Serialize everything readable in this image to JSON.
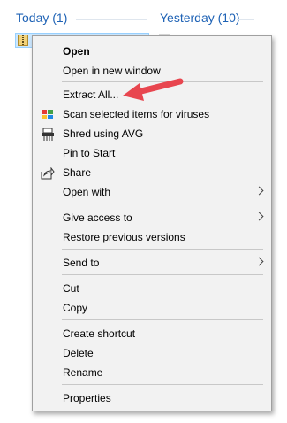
{
  "groups": {
    "today": "Today (1)",
    "yesterday": "Yesterday (10)"
  },
  "context_menu": {
    "items": [
      {
        "label": "Open",
        "bold": true
      },
      {
        "label": "Open in new window"
      },
      {
        "label": "Extract All..."
      },
      {
        "label": "Scan selected items for viruses",
        "icon": "avg-scan-icon"
      },
      {
        "label": "Shred using AVG",
        "icon": "shredder-icon"
      },
      {
        "label": "Pin to Start"
      },
      {
        "label": "Share",
        "icon": "share-icon"
      },
      {
        "label": "Open with",
        "submenu": true
      },
      {
        "label": "Give access to",
        "submenu": true
      },
      {
        "label": "Restore previous versions"
      },
      {
        "label": "Send to",
        "submenu": true
      },
      {
        "label": "Cut"
      },
      {
        "label": "Copy"
      },
      {
        "label": "Create shortcut"
      },
      {
        "label": "Delete"
      },
      {
        "label": "Rename"
      },
      {
        "label": "Properties"
      }
    ]
  },
  "colors": {
    "accent_header": "#1e62b5",
    "selection": "#cce8ff",
    "annotation_arrow": "#e8464f"
  }
}
